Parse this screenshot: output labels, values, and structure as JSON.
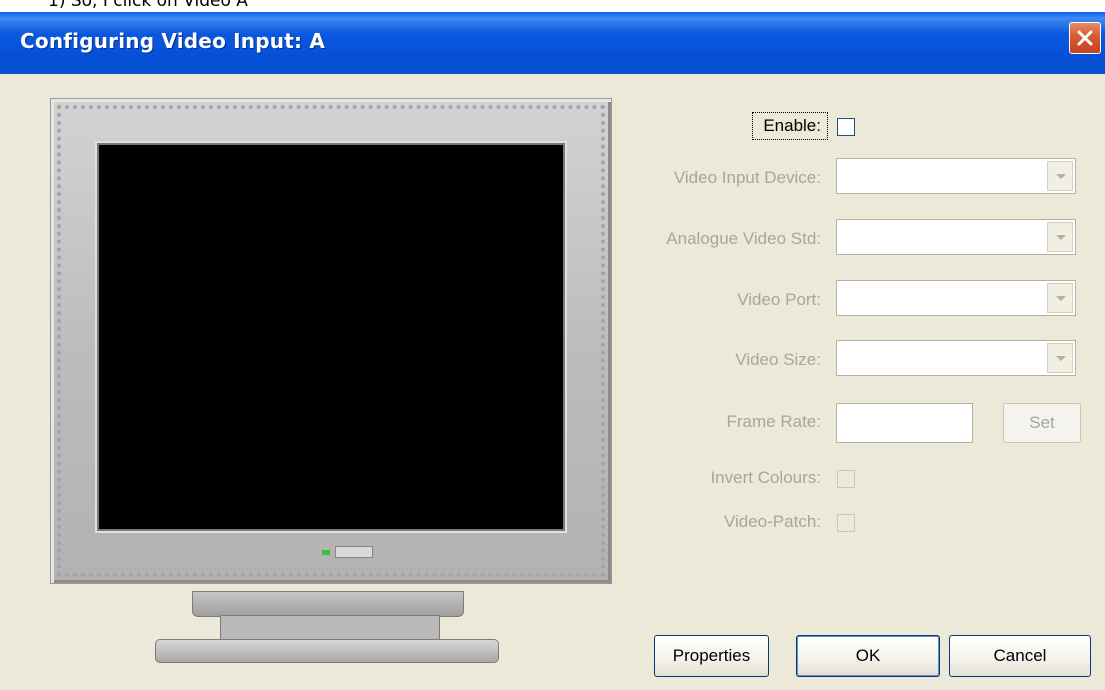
{
  "above_text": "1) So, I click on Video A",
  "window": {
    "title": "Configuring Video Input: A"
  },
  "form": {
    "enable_label": "Enable:",
    "video_input_device_label": "Video Input Device:",
    "analogue_video_std_label": "Analogue Video Std:",
    "video_port_label": "Video Port:",
    "video_size_label": "Video Size:",
    "frame_rate_label": "Frame Rate:",
    "frame_rate_value": "",
    "set_button": "Set",
    "invert_colours_label": "Invert Colours:",
    "video_patch_label": "Video-Patch:"
  },
  "buttons": {
    "properties": "Properties",
    "ok": "OK",
    "cancel": "Cancel"
  },
  "colors": {
    "title_bar": "#0a58e0",
    "dialog_bg": "#ece9d8",
    "disabled_text": "#a7a69c",
    "close_button": "#d65a34"
  },
  "icons": {
    "close": "close-icon",
    "dropdown": "chevron-down-icon",
    "monitor": "monitor-icon"
  }
}
